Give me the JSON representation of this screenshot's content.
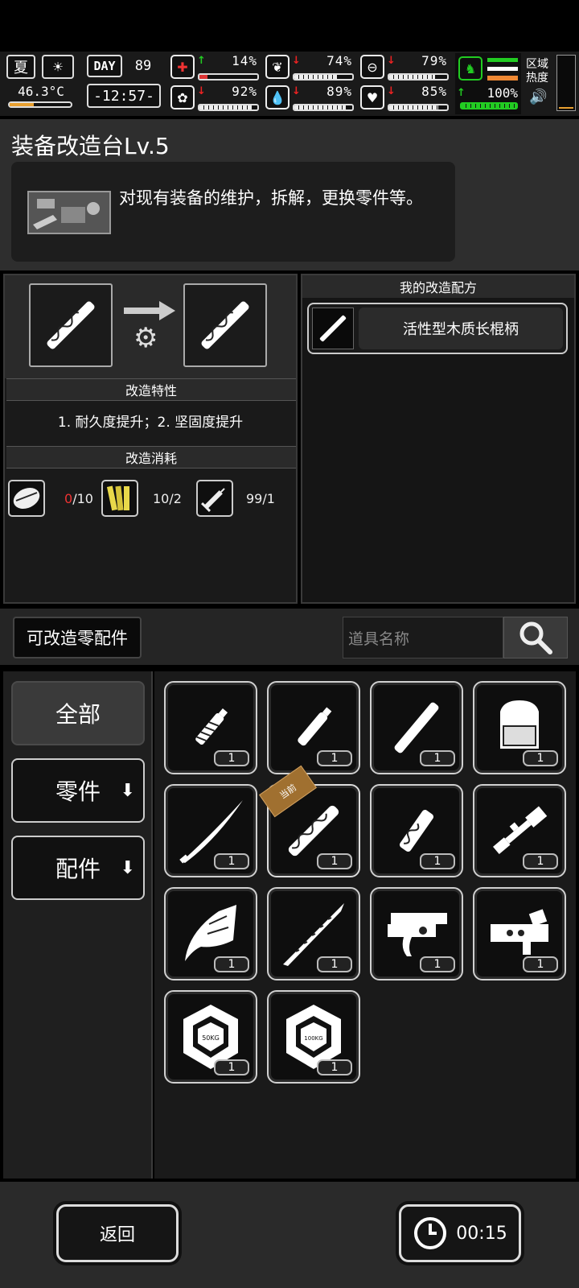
{
  "hud": {
    "season": "夏",
    "temperature": "46.3°C",
    "day_label": "DAY",
    "day": "89",
    "clock": "-12:57-",
    "region_heat_label": "区域\n热度",
    "stats": [
      {
        "icon": "medkit-icon",
        "trend": "up",
        "value": "14%",
        "fill": 0.14
      },
      {
        "icon": "stomach-icon",
        "trend": "down",
        "value": "74%",
        "fill": 0.74
      },
      {
        "icon": "sleep-icon",
        "trend": "down",
        "value": "79%",
        "fill": 0.79
      },
      {
        "icon": "brain-icon",
        "trend": "down",
        "value": "92%",
        "fill": 0.92
      },
      {
        "icon": "water-drop-icon",
        "trend": "down",
        "value": "89%",
        "fill": 0.89
      },
      {
        "icon": "heart-icon",
        "trend": "down",
        "value": "85%",
        "fill": 0.85
      },
      {
        "icon": "stamina-icon",
        "trend": "up",
        "value": "100%",
        "fill": 1.0
      }
    ]
  },
  "header": {
    "title": "装备改造台Lv.5",
    "description": "对现有装备的维护，拆解，更换零件等。"
  },
  "modify": {
    "traits_title": "改造特性",
    "traits_text": "1. 耐久度提升；2. 坚固度提升",
    "cost_title": "改造消耗",
    "costs": [
      {
        "icon": "fabric-icon",
        "have": "0",
        "need": "/10",
        "short": true
      },
      {
        "icon": "wood-planks-icon",
        "have": "10",
        "need": "/2",
        "short": false
      },
      {
        "icon": "syringe-tool-icon",
        "have": "99",
        "need": "/1",
        "short": false
      }
    ]
  },
  "recipes": {
    "title": "我的改造配方",
    "items": [
      {
        "label": "活性型木质长棍柄"
      }
    ]
  },
  "filter": {
    "button_label": "可改造零配件",
    "search_placeholder": "道具名称"
  },
  "categories": [
    {
      "label": "全部",
      "active": true
    },
    {
      "label": "零件",
      "active": false
    },
    {
      "label": "配件",
      "active": false
    }
  ],
  "grid_items": [
    {
      "icon": "wrapped-grip-icon",
      "qty": "1"
    },
    {
      "icon": "short-handle-icon",
      "qty": "1"
    },
    {
      "icon": "long-handle-icon",
      "qty": "1"
    },
    {
      "icon": "backpack-icon",
      "qty": "1"
    },
    {
      "icon": "katana-blade-icon",
      "qty": "1"
    },
    {
      "icon": "carved-staff-icon",
      "qty": "1",
      "current": "当前"
    },
    {
      "icon": "patterned-handle-icon",
      "qty": "1"
    },
    {
      "icon": "scope-icon",
      "qty": "1"
    },
    {
      "icon": "claw-blade-icon",
      "qty": "1"
    },
    {
      "icon": "serrated-blade-icon",
      "qty": "1"
    },
    {
      "icon": "trigger-assembly-icon",
      "qty": "1"
    },
    {
      "icon": "receiver-part-icon",
      "qty": "1"
    },
    {
      "icon": "weight-50kg-icon",
      "qty": "1",
      "label": "50KG"
    },
    {
      "icon": "weight-100kg-icon",
      "qty": "1",
      "label": "100KG"
    }
  ],
  "footer": {
    "back_label": "返回",
    "timer": "00:15"
  }
}
